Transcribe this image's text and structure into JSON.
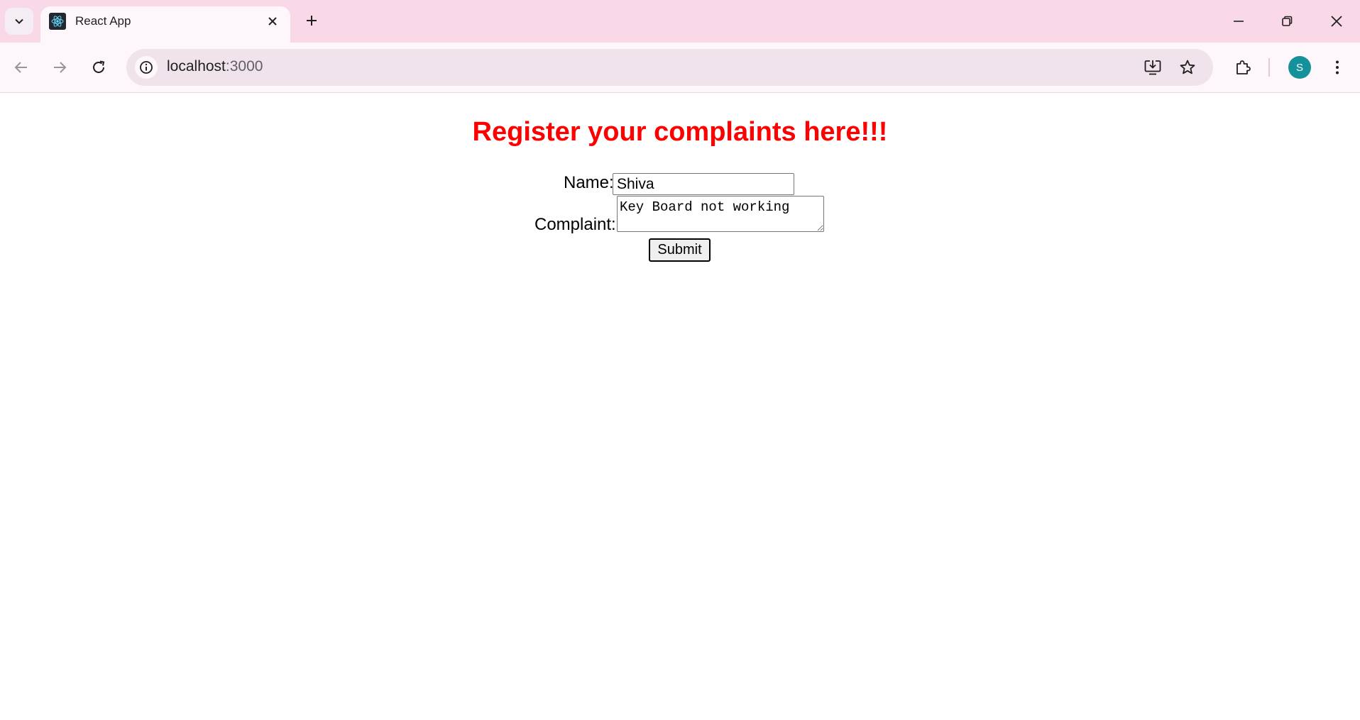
{
  "browser": {
    "tab_title": "React App",
    "url_host": "localhost",
    "url_port": ":3000",
    "profile_initial": "S",
    "colors": {
      "tabstrip_bg": "#f9d9e8",
      "toolbar_bg": "#fdf7fb",
      "omnibox_bg": "#f1e3ec",
      "avatar_bg": "#14919b"
    }
  },
  "page": {
    "heading": "Register your complaints here!!!",
    "heading_color": "#ff0000",
    "form": {
      "name_label": "Name:",
      "name_value": "Shiva",
      "complaint_label": "Complaint:",
      "complaint_value": "Key Board not working",
      "submit_label": "Submit"
    }
  }
}
